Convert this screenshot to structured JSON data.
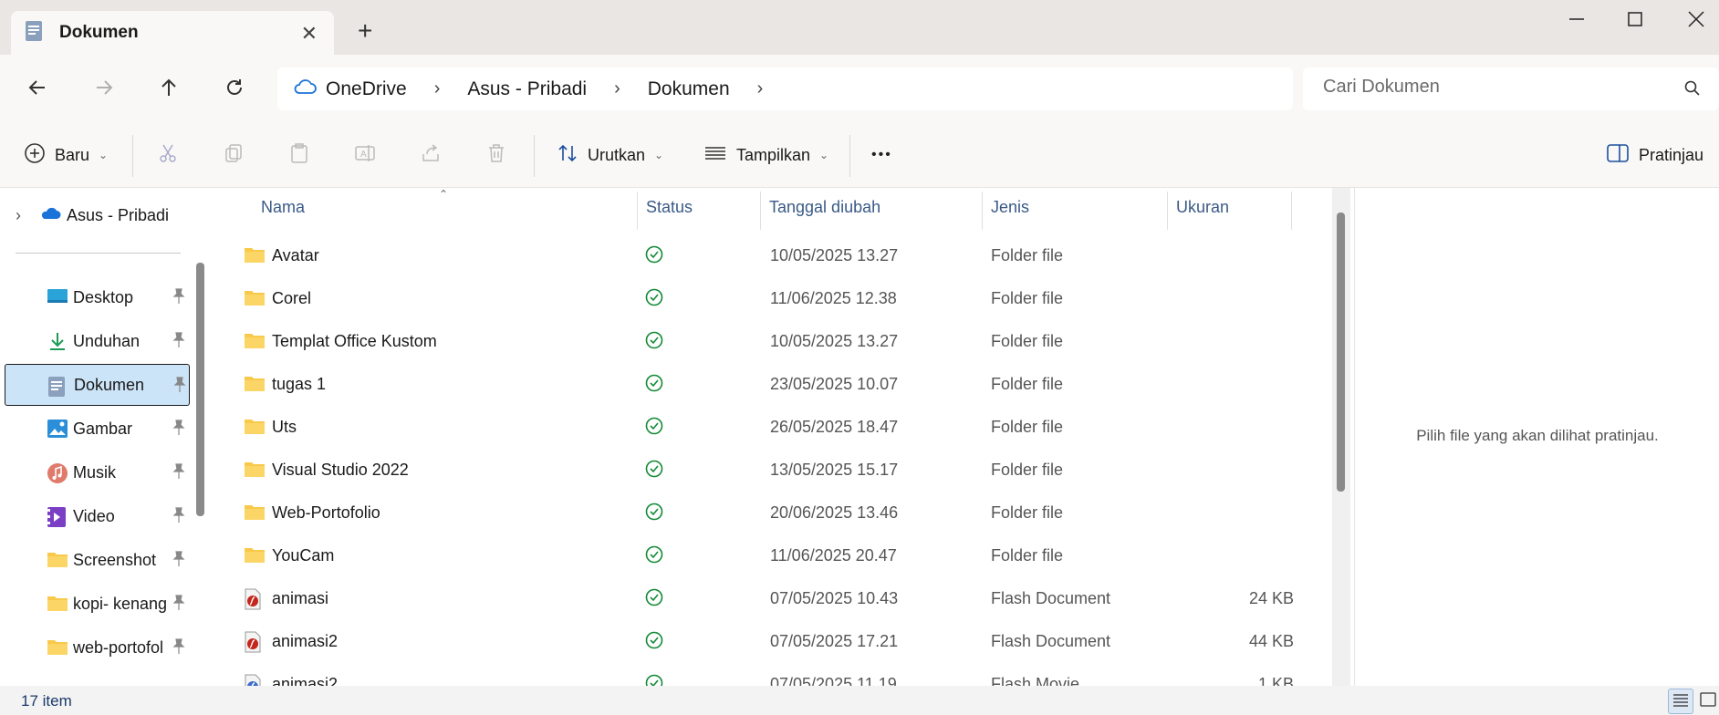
{
  "window": {
    "tab_title": "Dokumen",
    "new_tab_symbol": "+",
    "close_tab_symbol": "✕"
  },
  "nav": {
    "breadcrumb": [
      "OneDrive",
      "Asus - Pribadi",
      "Dokumen"
    ],
    "search_placeholder": "Cari Dokumen"
  },
  "toolbar": {
    "new_label": "Baru",
    "sort_label": "Urutkan",
    "view_label": "Tampilkan",
    "more_label": "•••",
    "preview_label": "Pratinjau"
  },
  "sidebar": {
    "root_label": "Asus - Pribadi",
    "items": [
      {
        "label": "Desktop",
        "icon": "desktop-icon"
      },
      {
        "label": "Unduhan",
        "icon": "download-icon"
      },
      {
        "label": "Dokumen",
        "icon": "documents-icon",
        "selected": true
      },
      {
        "label": "Gambar",
        "icon": "pictures-icon"
      },
      {
        "label": "Musik",
        "icon": "music-icon"
      },
      {
        "label": "Video",
        "icon": "video-icon"
      },
      {
        "label": "Screenshot",
        "icon": "folder-icon"
      },
      {
        "label": "kopi- kenang",
        "icon": "folder-icon"
      },
      {
        "label": "web-portofol",
        "icon": "folder-icon"
      }
    ]
  },
  "file_list": {
    "columns": [
      "Nama",
      "Status",
      "Tanggal diubah",
      "Jenis",
      "Ukuran"
    ],
    "rows": [
      {
        "name": "Avatar",
        "date": "10/05/2025 13.27",
        "type": "Folder file",
        "size": "",
        "icon": "folder-icon"
      },
      {
        "name": "Corel",
        "date": "11/06/2025 12.38",
        "type": "Folder file",
        "size": "",
        "icon": "folder-icon"
      },
      {
        "name": "Templat Office Kustom",
        "date": "10/05/2025 13.27",
        "type": "Folder file",
        "size": "",
        "icon": "folder-icon"
      },
      {
        "name": "tugas 1",
        "date": "23/05/2025 10.07",
        "type": "Folder file",
        "size": "",
        "icon": "folder-icon"
      },
      {
        "name": "Uts",
        "date": "26/05/2025 18.47",
        "type": "Folder file",
        "size": "",
        "icon": "folder-icon"
      },
      {
        "name": "Visual Studio 2022",
        "date": "13/05/2025 15.17",
        "type": "Folder file",
        "size": "",
        "icon": "folder-icon"
      },
      {
        "name": "Web-Portofolio",
        "date": "20/06/2025 13.46",
        "type": "Folder file",
        "size": "",
        "icon": "folder-icon"
      },
      {
        "name": "YouCam",
        "date": "11/06/2025 20.47",
        "type": "Folder file",
        "size": "",
        "icon": "folder-icon"
      },
      {
        "name": "animasi",
        "date": "07/05/2025 10.43",
        "type": "Flash Document",
        "size": "24 KB",
        "icon": "flash-document-icon"
      },
      {
        "name": "animasi2",
        "date": "07/05/2025 17.21",
        "type": "Flash Document",
        "size": "44 KB",
        "icon": "flash-document-icon"
      },
      {
        "name": "animasi2",
        "date": "07/05/2025 11.19",
        "type": "Flash Movie",
        "size": "1 KB",
        "icon": "flash-movie-icon"
      }
    ]
  },
  "preview": {
    "message": "Pilih file yang akan dilihat pratinjau."
  },
  "statusbar": {
    "item_count": "17 item"
  },
  "colors": {
    "accent": "#0067c0",
    "folder": "#f8c94a",
    "synced": "#138a36",
    "selected_bg": "#cce4f7"
  }
}
